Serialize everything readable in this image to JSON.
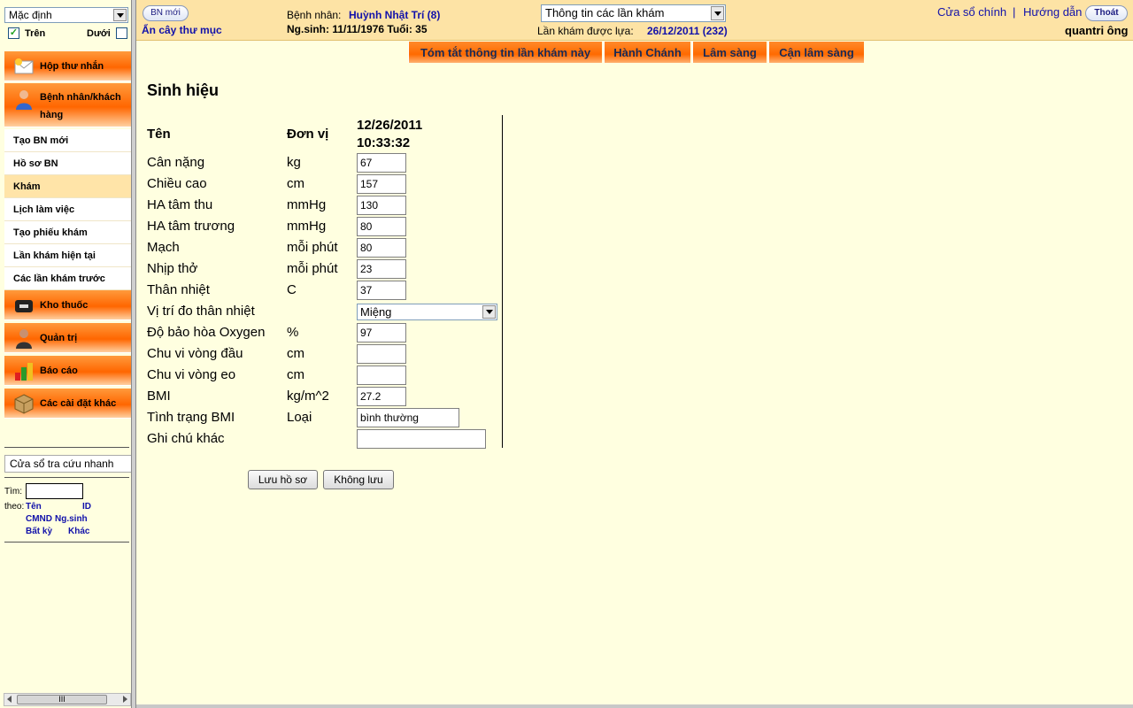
{
  "sidebar": {
    "view_select": "Mặc định",
    "tren_label": "Trên",
    "duoi_label": "Dưới",
    "tren_checked": true,
    "duoi_checked": false,
    "groups": {
      "inbox": "Hộp thư nhắn",
      "patients": "Bệnh nhân/khách hàng",
      "pharmacy": "Kho thuốc",
      "admin": "Quản trị",
      "reports": "Báo cáo",
      "settings": "Các cài đặt khác"
    },
    "items": {
      "new_patient": "Tạo BN mới",
      "records": "Hồ sơ BN",
      "exam_section": "Khám",
      "schedule": "Lịch làm việc",
      "create_exam": "Tạo phiếu khám",
      "current_exam": "Lần khám hiện tại",
      "previous_exams": "Các lần khám trước"
    },
    "quick_lookup": "Cửa sổ tra cứu nhanh",
    "search": {
      "tim_label": "Tìm:",
      "theo_label": "theo:",
      "options": [
        "Tên",
        "ID",
        "CMND",
        "Ng.sinh",
        "Bất kỳ",
        "Khác"
      ]
    },
    "scroll_grip": "III"
  },
  "header": {
    "new_button": "BN mới",
    "hide_tree": "Ẩn cây thư mục",
    "patient_label": "Bệnh nhân:",
    "patient_name": "Huỳnh Nhật Trí (8)",
    "dob_line": "Ng.sinh: 11/11/1976 Tuổi: 35",
    "visit_select": "Thông tin các lần khám",
    "selected_visit_label": "Lần khám được lựa:",
    "selected_visit_value": "26/12/2011 (232)",
    "main_window": "Cửa sổ chính",
    "separator": "|",
    "help": "Hướng dẫn",
    "logout": "Thoát",
    "user": "quantri ông"
  },
  "tabs": [
    "Tóm tắt thông tin lần khám này",
    "Hành Chánh",
    "Lâm sàng",
    "Cận lâm sàng"
  ],
  "vitals": {
    "title": "Sinh hiệu",
    "columns": {
      "name": "Tên",
      "unit": "Đơn vị",
      "date": "12/26/2011",
      "time": "10:33:32"
    },
    "rows": [
      {
        "label": "Cân nặng",
        "unit": "kg",
        "value": "67"
      },
      {
        "label": "Chiều cao",
        "unit": "cm",
        "value": "157"
      },
      {
        "label": "HA tâm thu",
        "unit": "mmHg",
        "value": "130"
      },
      {
        "label": "HA tâm trương",
        "unit": "mmHg",
        "value": "80"
      },
      {
        "label": "Mạch",
        "unit": "mỗi phút",
        "value": "80"
      },
      {
        "label": "Nhịp thở",
        "unit": "mỗi phút",
        "value": "23"
      },
      {
        "label": "Thân nhiệt",
        "unit": "C",
        "value": "37"
      },
      {
        "label": "Vị trí đo thân nhiệt",
        "unit": "",
        "value": "Miệng"
      },
      {
        "label": "Độ bảo hòa Oxygen",
        "unit": "%",
        "value": "97"
      },
      {
        "label": "Chu vi vòng đầu",
        "unit": "cm",
        "value": ""
      },
      {
        "label": "Chu vi vòng eo",
        "unit": "cm",
        "value": ""
      },
      {
        "label": "BMI",
        "unit": "kg/m^2",
        "value": "27.2"
      },
      {
        "label": "Tình trạng BMI",
        "unit": "Loại",
        "value": "bình thường"
      },
      {
        "label": "Ghi chú khác",
        "unit": "",
        "value": ""
      }
    ],
    "save_button": "Lưu hồ sơ",
    "cancel_button": "Không lưu"
  }
}
